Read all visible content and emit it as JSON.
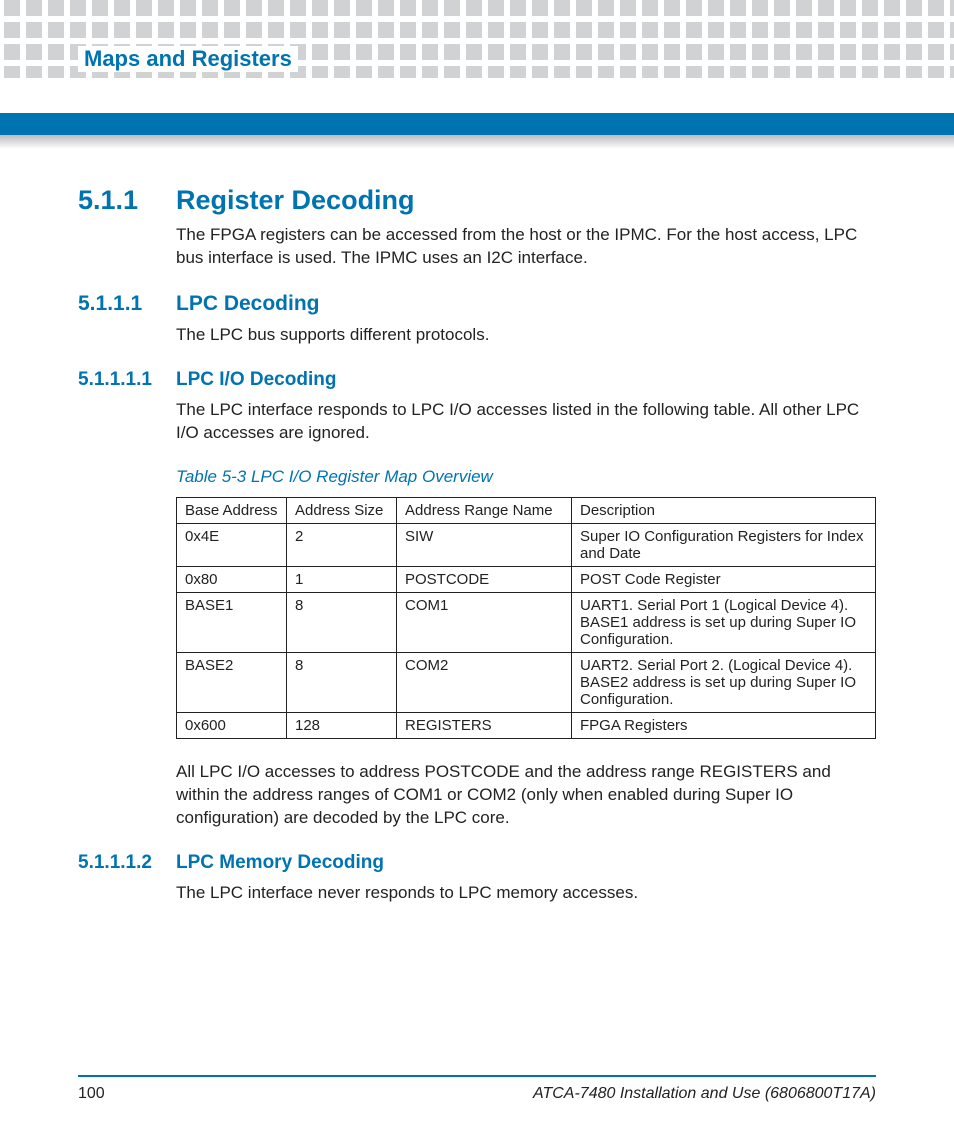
{
  "header": {
    "chapter": "Maps and Registers"
  },
  "sections": {
    "s511": {
      "num": "5.1.1",
      "title": "Register Decoding",
      "body": "The FPGA registers can be accessed from the host or the IPMC. For the host access, LPC bus interface is used. The IPMC uses an I2C interface."
    },
    "s5111": {
      "num": "5.1.1.1",
      "title": "LPC Decoding",
      "body": "The LPC bus supports different protocols."
    },
    "s51111": {
      "num": "5.1.1.1.1",
      "title": "LPC I/O Decoding",
      "body": "The LPC interface responds to LPC I/O accesses listed in the following table. All other LPC I/O accesses are ignored."
    },
    "s51112": {
      "num": "5.1.1.1.2",
      "title": "LPC Memory Decoding",
      "body": "The LPC interface never responds to LPC memory accesses."
    }
  },
  "table": {
    "caption": "Table 5-3 LPC I/O Register Map Overview",
    "headers": [
      "Base Address",
      "Address Size",
      "Address Range Name",
      "Description"
    ],
    "rows": [
      [
        "0x4E",
        "2",
        "SIW",
        "Super IO Configuration Registers for Index and Date"
      ],
      [
        "0x80",
        "1",
        "POSTCODE",
        "POST Code Register"
      ],
      [
        "BASE1",
        "8",
        "COM1",
        "UART1. Serial Port 1 (Logical Device 4). BASE1 address is set up during Super IO Configuration."
      ],
      [
        "BASE2",
        "8",
        "COM2",
        "UART2. Serial Port 2. (Logical Device 4). BASE2 address is set up during Super IO Configuration."
      ],
      [
        "0x600",
        "128",
        "REGISTERS",
        "FPGA Registers"
      ]
    ],
    "after": "All LPC I/O accesses to address POSTCODE and the address range REGISTERS and within the address ranges of COM1 or COM2 (only when enabled during Super IO configuration) are decoded by the LPC core."
  },
  "footer": {
    "page": "100",
    "doc": "ATCA-7480 Installation and Use (6806800T17A)"
  }
}
